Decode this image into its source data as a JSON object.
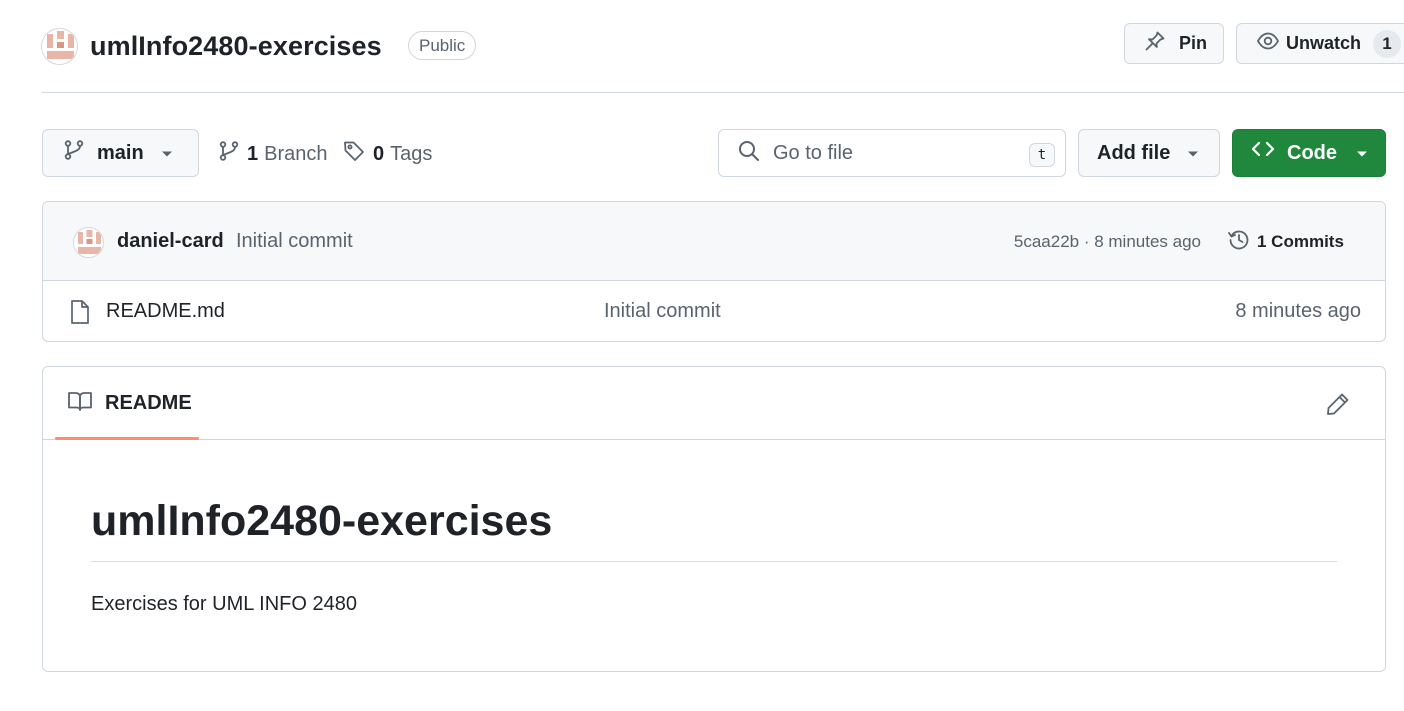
{
  "repo": {
    "name": "umlInfo2480-exercises",
    "visibility": "Public"
  },
  "header": {
    "pin_label": "Pin",
    "watch_label": "Unwatch",
    "watch_count": "1"
  },
  "toolbar": {
    "branch": "main",
    "branch_count": "1",
    "branch_label": "Branch",
    "tag_count": "0",
    "tag_label": "Tags",
    "search_placeholder": "Go to file",
    "search_shortcut": "t",
    "add_file_label": "Add file",
    "code_label": "Code"
  },
  "latest_commit": {
    "author": "daniel-card",
    "message": "Initial commit",
    "meta": "5caa22b · 8 minutes ago",
    "commits_label": "1 Commits"
  },
  "files": [
    {
      "name": "README.md",
      "commit": "Initial commit",
      "age": "8 minutes ago",
      "icon": "file-icon"
    }
  ],
  "readme": {
    "tab_label": "README",
    "title": "umlInfo2480-exercises",
    "body": "Exercises for UML INFO 2480"
  },
  "colors": {
    "primary_green": "#1f883d",
    "tab_underline": "#fd8c73",
    "border": "#d0d7de",
    "muted_text": "#59636e"
  }
}
